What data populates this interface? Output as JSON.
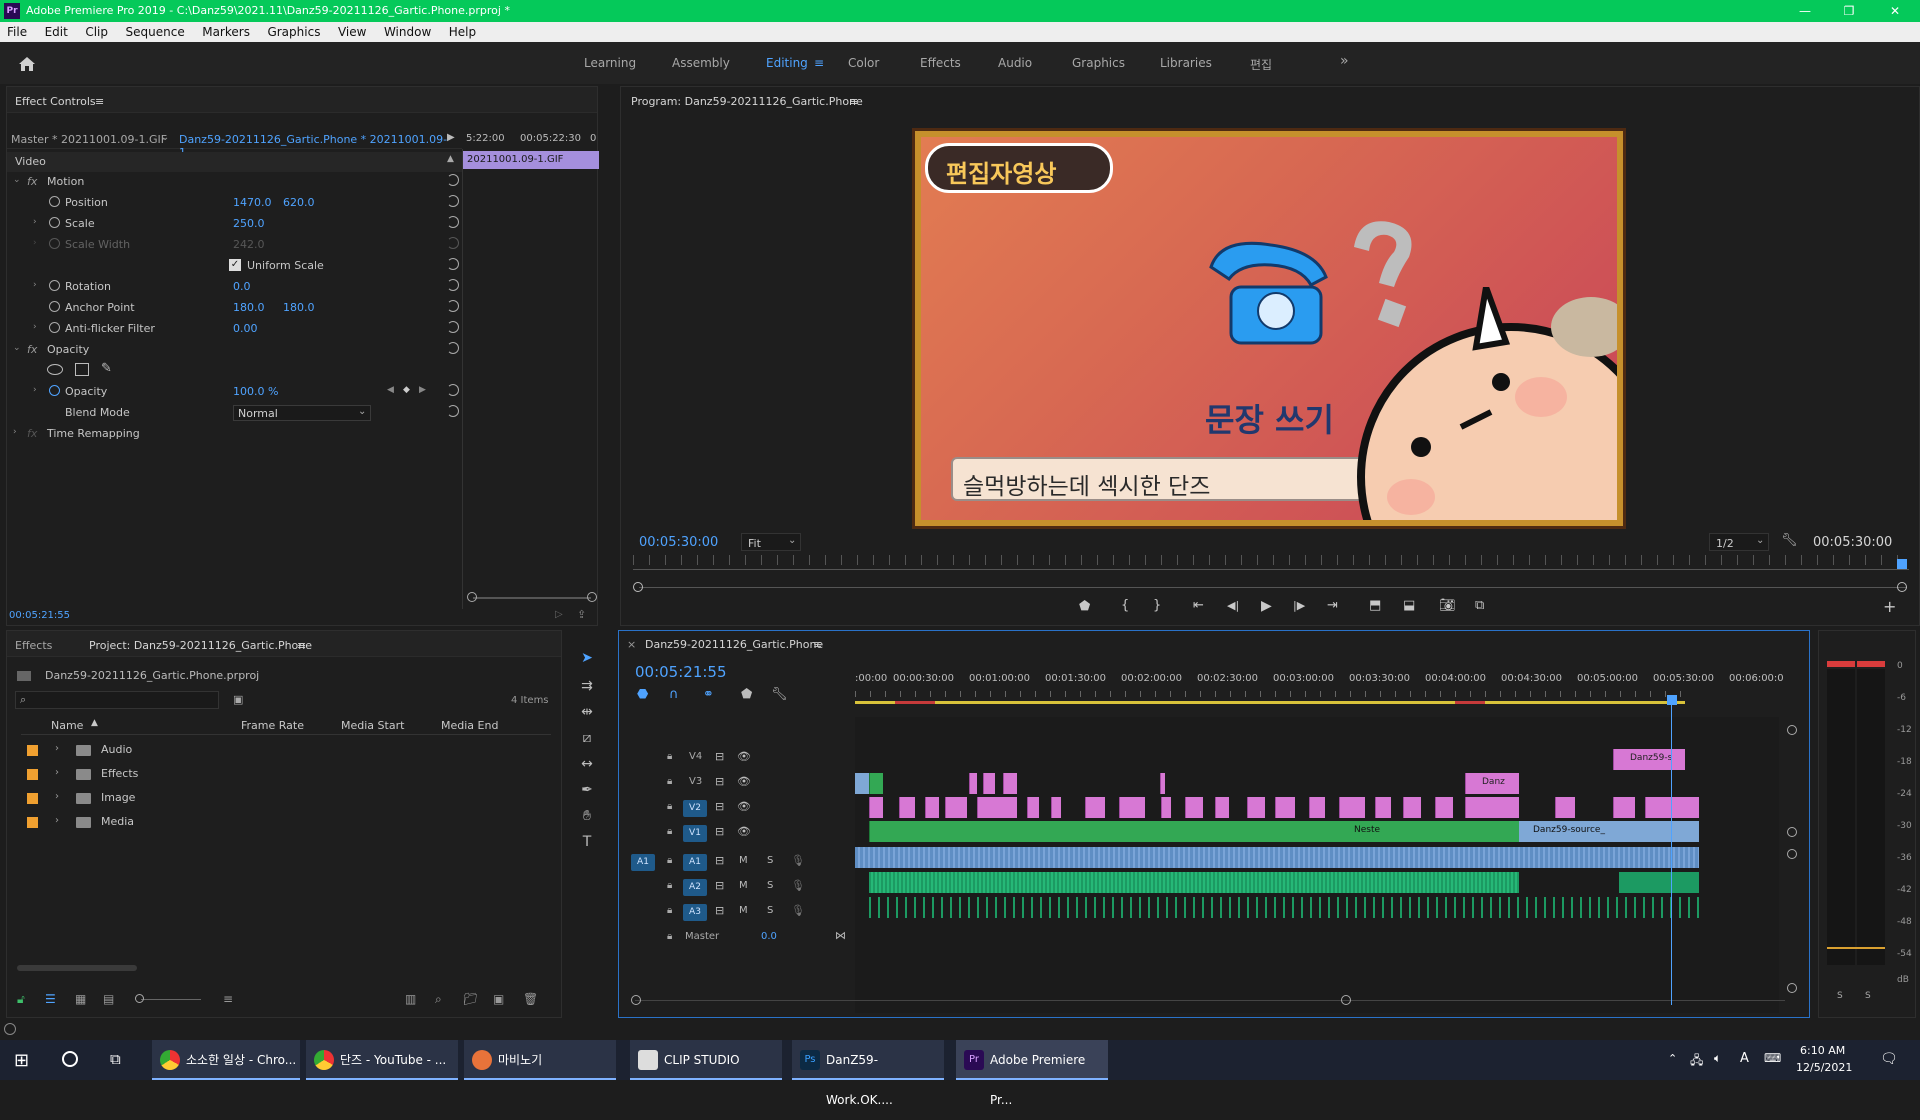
{
  "titlebar": {
    "app_logo": "Pr",
    "title": "Adobe Premiere Pro 2019 - C:\\Danz59\\2021.11\\Danz59-20211126_Gartic.Phone.prproj *",
    "minimize": "—",
    "restore": "❐",
    "close": "✕"
  },
  "menu": [
    "File",
    "Edit",
    "Clip",
    "Sequence",
    "Markers",
    "Graphics",
    "View",
    "Window",
    "Help"
  ],
  "workspaces": {
    "tabs": [
      "Learning",
      "Assembly",
      "Editing",
      "Color",
      "Effects",
      "Audio",
      "Graphics",
      "Libraries",
      "편집"
    ],
    "active": "Editing",
    "more": "»"
  },
  "effect_controls": {
    "panel_title": "Effect Controls",
    "master_label": "Master * 20211001.09-1.GIF",
    "sequence_label": "Danz59-20211126_Gartic.Phone * 20211001.09-1...",
    "time_start": "5:22:00",
    "time_end": "00:05:22:30",
    "time_zero": "0",
    "clip_name": "20211001.09-1.GIF",
    "section_video": "Video",
    "motion": "Motion",
    "position": {
      "label": "Position",
      "x": "1470.0",
      "y": "620.0"
    },
    "scale": {
      "label": "Scale",
      "value": "250.0"
    },
    "scale_width": {
      "label": "Scale Width",
      "value": "242.0"
    },
    "uniform_scale": "Uniform Scale",
    "rotation": {
      "label": "Rotation",
      "value": "0.0"
    },
    "anchor_point": {
      "label": "Anchor Point",
      "x": "180.0",
      "y": "180.0"
    },
    "anti_flicker": {
      "label": "Anti-flicker Filter",
      "value": "0.00"
    },
    "opacity_section": "Opacity",
    "opacity": {
      "label": "Opacity",
      "value": "100.0 %"
    },
    "blend_mode": {
      "label": "Blend Mode",
      "value": "Normal"
    },
    "time_remapping": "Time Remapping",
    "current_time": "00:05:21:55"
  },
  "program_monitor": {
    "title": "Program: Danz59-20211126_Gartic.Phone",
    "timecode": "00:05:30:00",
    "fit": "Fit",
    "resolution": "1/2",
    "timecode_right": "00:05:30:00",
    "badge_text": "편집자영상",
    "caption_title": "문장 쓰기",
    "input_text": "슬먹방하는데 섹시한 단즈"
  },
  "project": {
    "tab_effects": "Effects",
    "tab_project": "Project: Danz59-20211126_Gartic.Phone",
    "file": "Danz59-20211126_Gartic.Phone.prproj",
    "item_count": "4 Items",
    "columns": [
      "Name",
      "Frame Rate",
      "Media Start",
      "Media End"
    ],
    "bins": [
      "Audio",
      "Effects",
      "Image",
      "Media"
    ]
  },
  "timeline": {
    "tab": "Danz59-20211126_Gartic.Phone",
    "timecode": "00:05:21:55",
    "ruler": [
      ":00:00",
      "00:00:30:00",
      "00:01:00:00",
      "00:01:30:00",
      "00:02:00:00",
      "00:02:30:00",
      "00:03:00:00",
      "00:03:30:00",
      "00:04:00:00",
      "00:04:30:00",
      "00:05:00:00",
      "00:05:30:00",
      "00:06:00:0"
    ],
    "video_tracks": [
      "V4",
      "V3",
      "V2",
      "V1"
    ],
    "audio_tracks": [
      "A1",
      "A2",
      "A3"
    ],
    "source_target": "A1",
    "master": "Master",
    "master_value": "0.0",
    "clip_labels": [
      "Danz59-s",
      "Danz",
      "Neste",
      "Danz59-source_"
    ],
    "mute": "M",
    "solo": "S"
  },
  "audio_meter": {
    "scale": [
      "0",
      "-6",
      "-12",
      "-18",
      "-24",
      "-30",
      "-36",
      "-42",
      "-48",
      "-54",
      "dB"
    ],
    "solo_left": "S",
    "solo_right": "S"
  },
  "taskbar": {
    "items": [
      "소소한 일상 - Chro...",
      "단즈 - YouTube - ...",
      "마비노기",
      "CLIP STUDIO",
      "DanZ59-Work.OK....",
      "Adobe Premiere Pr..."
    ],
    "time": "6:10 AM",
    "date": "12/5/2021",
    "ime": "A"
  },
  "colors": {
    "titlebar": "#05c95a",
    "accent_blue": "#4fa3ff",
    "clip_pink": "#d778d4",
    "clip_green": "#33a854",
    "audio_blue": "#5f8ec4"
  }
}
